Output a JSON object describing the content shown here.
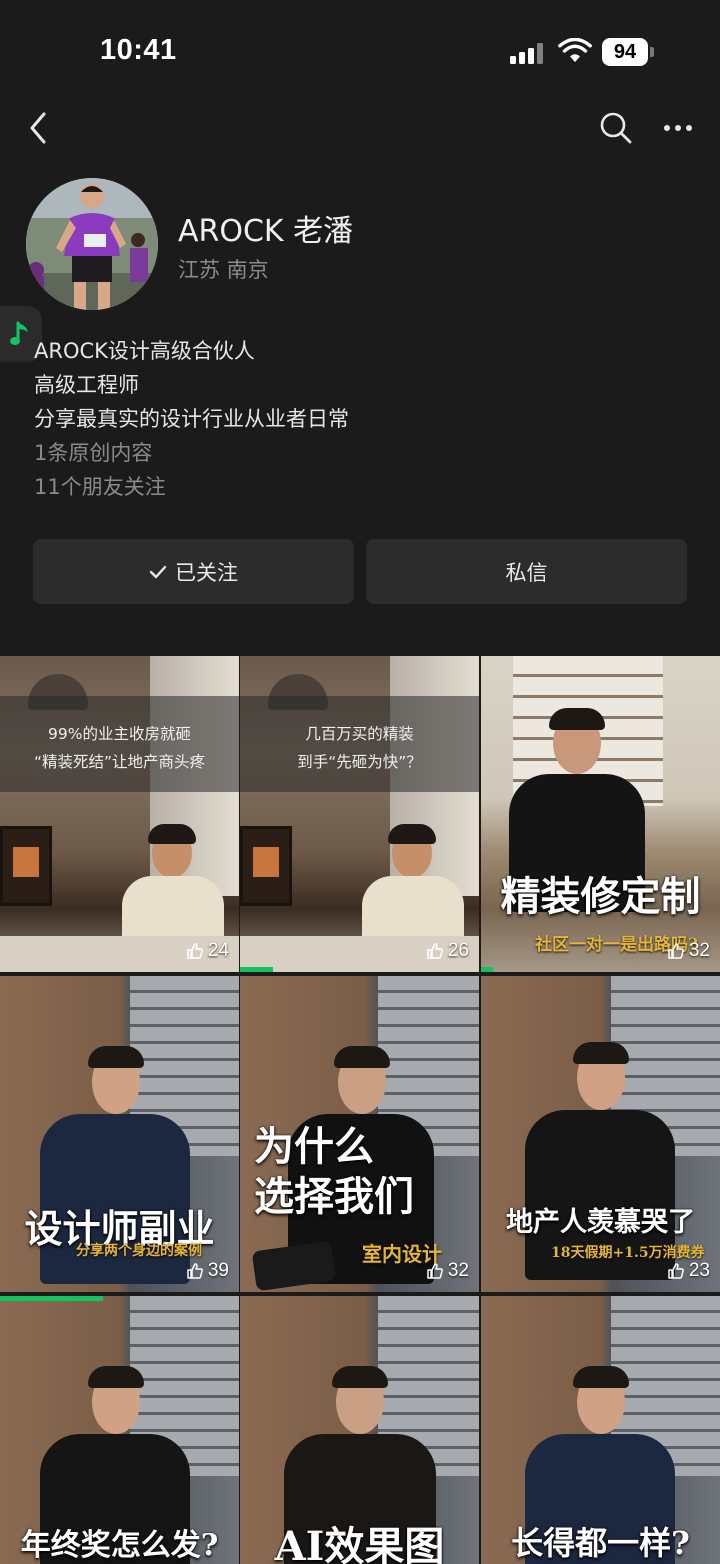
{
  "status_bar": {
    "time": "10:41",
    "battery": "94"
  },
  "profile": {
    "name": "AROCK 老潘",
    "location": "江苏 南京",
    "bio": [
      "AROCK设计高级合伙人",
      "高级工程师",
      "分享最真实的设计行业从业者日常"
    ],
    "original_count": "1条原创内容",
    "friends_following": "11个朋友关注"
  },
  "actions": {
    "follow_label": "已关注",
    "message_label": "私信"
  },
  "colors": {
    "accent_green": "#15c260",
    "subtitle_gold": "#e6b536",
    "background": "#1b1b1b"
  },
  "videos": [
    {
      "overlay": [
        "99%的业主收房就砸",
        "“精装死结”让地产商头疼"
      ],
      "title": "",
      "subtitle": "",
      "likes": "24",
      "progress": 0
    },
    {
      "overlay": [
        "几百万买的精装",
        "到手“先砸为快”？"
      ],
      "title": "",
      "subtitle": "",
      "likes": "26",
      "progress": 0.14
    },
    {
      "overlay": [],
      "title": "精装修定制",
      "subtitle": "社区一对一是出路吗?",
      "likes": "32",
      "progress": 0.05
    },
    {
      "overlay": [],
      "title": "设计师副业",
      "subtitle": "分享两个身边的案例",
      "likes": "39",
      "progress": 0
    },
    {
      "overlay": [],
      "title": "为什么\n选择我们",
      "subtitle": "室内设计",
      "likes": "32",
      "progress": 0
    },
    {
      "overlay": [],
      "title": "地产人羡慕哭了",
      "subtitle": "18天假期+1.5万消费券",
      "likes": "23",
      "progress": 0
    },
    {
      "overlay": [],
      "title": "年终奖怎么发?",
      "subtitle": "",
      "likes": "",
      "progress": 0.43
    },
    {
      "overlay": [],
      "title": "AI效果图",
      "subtitle": "",
      "likes": "",
      "progress": 0
    },
    {
      "overlay": [],
      "title": "长得都一样?",
      "subtitle": "",
      "likes": "",
      "progress": 0
    }
  ]
}
